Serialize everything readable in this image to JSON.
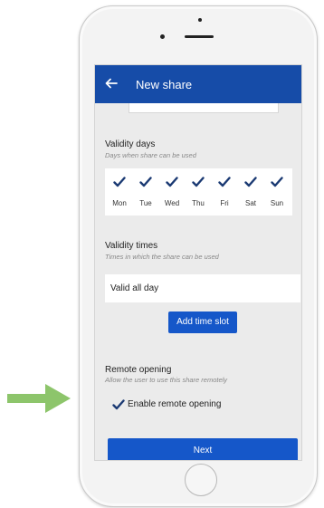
{
  "colors": {
    "accent": "#164ca8",
    "primary_button": "#1557c9",
    "arrow": "#8dc56b",
    "check": "#1b3a73"
  },
  "appbar": {
    "back_icon": "arrow-left-icon",
    "title": "New share"
  },
  "validity_days": {
    "title": "Validity days",
    "subtitle": "Days when share can be used",
    "days": [
      {
        "label": "Mon",
        "checked": true
      },
      {
        "label": "Tue",
        "checked": true
      },
      {
        "label": "Wed",
        "checked": true
      },
      {
        "label": "Thu",
        "checked": true
      },
      {
        "label": "Fri",
        "checked": true
      },
      {
        "label": "Sat",
        "checked": true
      },
      {
        "label": "Sun",
        "checked": true
      }
    ]
  },
  "validity_times": {
    "title": "Validity times",
    "subtitle": "Times in which the share can be used",
    "value": "Valid all day",
    "add_button": "Add time slot"
  },
  "remote_opening": {
    "title": "Remote opening",
    "subtitle": "Allow the user to use this share remotely",
    "checkbox_label": "Enable remote opening",
    "checked": true
  },
  "footer": {
    "next_button": "Next"
  }
}
